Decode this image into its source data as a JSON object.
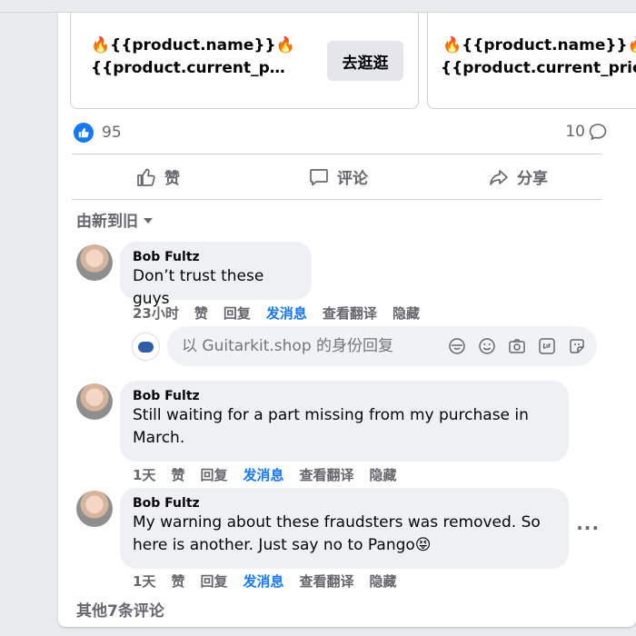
{
  "products": [
    {
      "fire": "🔥",
      "name": "{{product.name}}",
      "price": "{{product.current_price...",
      "button": "去逛逛"
    },
    {
      "fire": "🔥",
      "name": "{{product.name}}",
      "price": "{{product.current_price..."
    }
  ],
  "reactions": {
    "count": "95",
    "comment_count": "10"
  },
  "actions": {
    "like": "赞",
    "comment": "评论",
    "share": "分享"
  },
  "sort": {
    "label": "由新到旧"
  },
  "comments": [
    {
      "author": "Bob Fultz",
      "text": "Don’t trust these guys",
      "time": "23小时",
      "like": "赞",
      "reply": "回复",
      "message": "发消息",
      "translate": "查看翻译",
      "hide": "隐藏"
    },
    {
      "author": "Bob Fultz",
      "text": "Still waiting for a part missing from my purchase in March.",
      "time": "1天",
      "like": "赞",
      "reply": "回复",
      "message": "发消息",
      "translate": "查看翻译",
      "hide": "隐藏"
    },
    {
      "author": "Bob Fultz",
      "text": "My warning about these fraudsters was removed. So here is another. Just say no to Pango😝",
      "time": "1天",
      "like": "赞",
      "reply": "回复",
      "message": "发消息",
      "translate": "查看翻译",
      "hide": "隐藏"
    }
  ],
  "reply": {
    "placeholder": "以 Guitarkit.shop 的身份回复"
  },
  "more_options": "···",
  "view_more": "其他7条评论"
}
